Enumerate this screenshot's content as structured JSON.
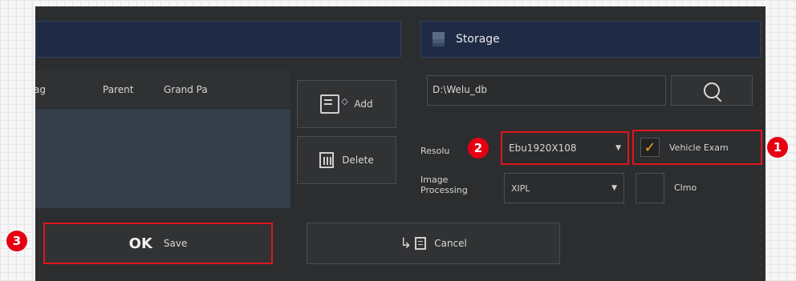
{
  "storage": {
    "title": "Storage",
    "path_value": "D:\\Welu_db",
    "search_icon": "search-icon"
  },
  "table": {
    "columns": [
      "ag",
      "Parent",
      "Grand Pa"
    ]
  },
  "list_buttons": {
    "add_label": "Add",
    "delete_label": "Delete"
  },
  "options": {
    "resolution_label": "Resolu",
    "resolution_value": "Ebu1920X108",
    "vehicle_exam_label": "Vehicle Exam",
    "vehicle_exam_checked": true,
    "image_processing_label": "Image\nProcessing",
    "image_processing_value": "XIPL",
    "clmo_label": "Clmo",
    "clmo_checked": false
  },
  "footer": {
    "ok_text": "OK",
    "save_text": "Save",
    "cancel_label": "Cancel"
  },
  "markers": [
    "1",
    "2",
    "3"
  ],
  "colors": {
    "highlight": "#e0161c",
    "marker": "#e60012",
    "check": "#f0a020"
  }
}
